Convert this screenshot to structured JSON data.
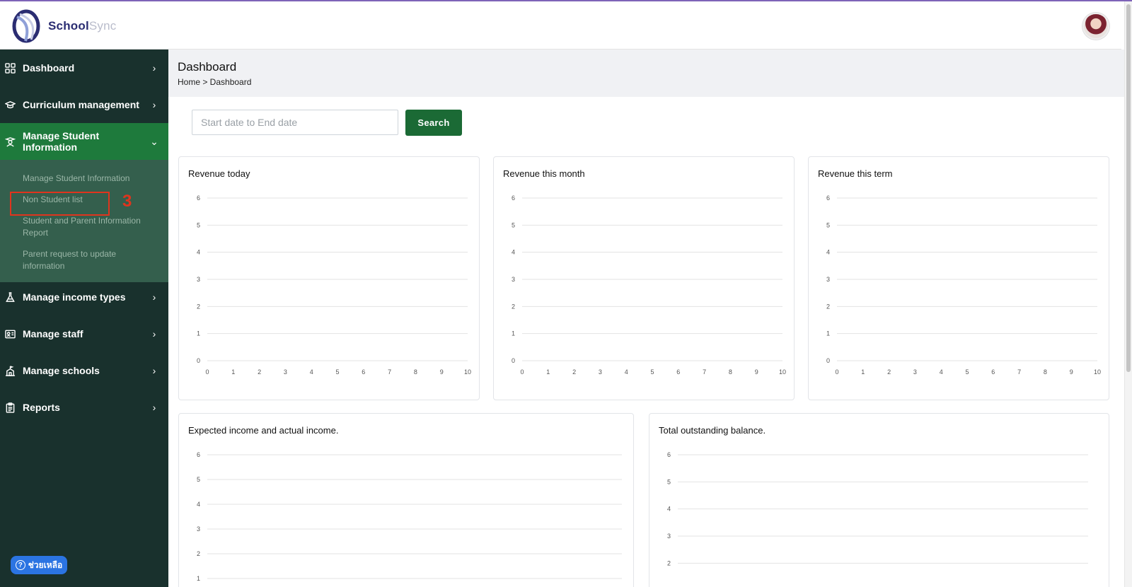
{
  "app": {
    "logo_text_a": "School",
    "logo_text_b": "Sync",
    "colors": {
      "accent": "#7e63b8",
      "sidebar_bg": "#19312d",
      "active_green": "#1e7a3c",
      "submenu_bg": "#345f4d",
      "button_green": "#1b6a35",
      "annotation_red": "#e0341d"
    }
  },
  "sidebar": {
    "items": [
      {
        "label": "Dashboard",
        "icon": "grid-icon",
        "chevron": "›"
      },
      {
        "label": "Curriculum management",
        "icon": "graduation-cap-icon",
        "chevron": "›"
      },
      {
        "label": "Manage Student Information",
        "icon": "student-icon",
        "chevron": "⌄"
      },
      {
        "label": "Manage income types",
        "icon": "flask-icon",
        "chevron": "›"
      },
      {
        "label": "Manage staff",
        "icon": "id-card-icon",
        "chevron": "›"
      },
      {
        "label": "Manage schools",
        "icon": "school-icon",
        "chevron": "›"
      },
      {
        "label": "Reports",
        "icon": "clipboard-icon",
        "chevron": "›"
      }
    ],
    "submenu": [
      "Manage Student Information",
      "Non Student list",
      "Student and Parent Information Report",
      "Parent request to update information"
    ],
    "annotation_number": "3",
    "help_label": "ช่วยเหลือ"
  },
  "header": {
    "page_title": "Dashboard",
    "breadcrumb": "Home > Dashboard"
  },
  "filters": {
    "date_placeholder": "Start date to End date",
    "search_label": "Search"
  },
  "cards": {
    "revenue_today": "Revenue today",
    "revenue_month": "Revenue this month",
    "revenue_term": "Revenue this term",
    "expected_income": "Expected income and actual income.",
    "outstanding": "Total outstanding balance."
  },
  "chart_data": [
    {
      "type": "line",
      "title": "Revenue today",
      "x_ticks": [
        0,
        1,
        2,
        3,
        4,
        5,
        6,
        7,
        8,
        9,
        10
      ],
      "y_ticks": [
        0,
        1,
        2,
        3,
        4,
        5,
        6
      ],
      "xlim": [
        0,
        10
      ],
      "ylim": [
        0,
        6
      ],
      "grid": true,
      "series": []
    },
    {
      "type": "line",
      "title": "Revenue this month",
      "x_ticks": [
        0,
        1,
        2,
        3,
        4,
        5,
        6,
        7,
        8,
        9,
        10
      ],
      "y_ticks": [
        0,
        1,
        2,
        3,
        4,
        5,
        6
      ],
      "xlim": [
        0,
        10
      ],
      "ylim": [
        0,
        6
      ],
      "grid": true,
      "series": []
    },
    {
      "type": "line",
      "title": "Revenue this term",
      "x_ticks": [
        0,
        1,
        2,
        3,
        4,
        5,
        6,
        7,
        8,
        9,
        10
      ],
      "y_ticks": [
        0,
        1,
        2,
        3,
        4,
        5,
        6
      ],
      "xlim": [
        0,
        10
      ],
      "ylim": [
        0,
        6
      ],
      "grid": true,
      "series": []
    },
    {
      "type": "line",
      "title": "Expected income and actual income.",
      "y_ticks": [
        1,
        2,
        3,
        4,
        5,
        6
      ],
      "ylim": [
        0,
        6
      ],
      "grid": true,
      "series": []
    },
    {
      "type": "line",
      "title": "Total outstanding balance.",
      "y_ticks": [
        2,
        3,
        4,
        5,
        6
      ],
      "ylim": [
        0,
        6
      ],
      "grid": true,
      "series": []
    }
  ]
}
